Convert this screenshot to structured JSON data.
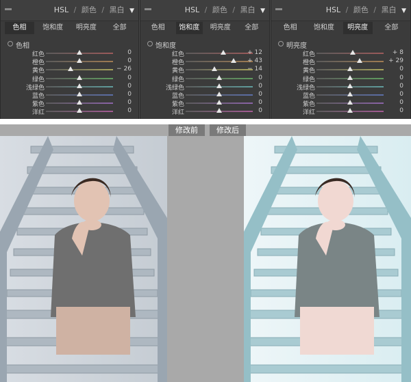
{
  "hsl_panels": [
    {
      "title": "HSL",
      "sep": "/",
      "title2": "颜色",
      "title3": "黑白",
      "tabs": [
        "色相",
        "饱和度",
        "明亮度",
        "全部"
      ],
      "active_tab": 0,
      "section_title": "色相",
      "rows": [
        {
          "label": "红色",
          "value": "0",
          "knob": 0.5,
          "track": "#9b5a5a"
        },
        {
          "label": "橙色",
          "value": "0",
          "knob": 0.5,
          "track": "#a07b52"
        },
        {
          "label": "黄色",
          "value": "− 26",
          "knob": 0.37,
          "track": "#a7a35b"
        },
        {
          "label": "绿色",
          "value": "0",
          "knob": 0.5,
          "track": "#5f9b5f"
        },
        {
          "label": "浅绿色",
          "value": "0",
          "knob": 0.5,
          "track": "#5f9d9d"
        },
        {
          "label": "蓝色",
          "value": "0",
          "knob": 0.5,
          "track": "#5b6ea7"
        },
        {
          "label": "紫色",
          "value": "0",
          "knob": 0.5,
          "track": "#8a63a7"
        },
        {
          "label": "洋红",
          "value": "0",
          "knob": 0.5,
          "track": "#a35a93"
        }
      ]
    },
    {
      "title": "HSL",
      "sep": "/",
      "title2": "颜色",
      "title3": "黑白",
      "tabs": [
        "色相",
        "饱和度",
        "明亮度",
        "全部"
      ],
      "active_tab": 1,
      "section_title": "饱和度",
      "rows": [
        {
          "label": "红色",
          "value": "+ 12",
          "knob": 0.56,
          "track": "#9b5a5a"
        },
        {
          "label": "橙色",
          "value": "+ 43",
          "knob": 0.71,
          "track": "#a07b52"
        },
        {
          "label": "黄色",
          "value": "− 14",
          "knob": 0.43,
          "track": "#a7a35b"
        },
        {
          "label": "绿色",
          "value": "0",
          "knob": 0.5,
          "track": "#5f9b5f"
        },
        {
          "label": "浅绿色",
          "value": "0",
          "knob": 0.5,
          "track": "#5f9d9d"
        },
        {
          "label": "蓝色",
          "value": "0",
          "knob": 0.5,
          "track": "#5b6ea7"
        },
        {
          "label": "紫色",
          "value": "0",
          "knob": 0.5,
          "track": "#8a63a7"
        },
        {
          "label": "洋红",
          "value": "0",
          "knob": 0.5,
          "track": "#a35a93"
        }
      ]
    },
    {
      "title": "HSL",
      "sep": "/",
      "title2": "颜色",
      "title3": "黑白",
      "tabs": [
        "色相",
        "饱和度",
        "明亮度",
        "全部"
      ],
      "active_tab": 2,
      "section_title": "明亮度",
      "rows": [
        {
          "label": "红色",
          "value": "+ 8",
          "knob": 0.54,
          "track": "#9b5a5a"
        },
        {
          "label": "橙色",
          "value": "+ 29",
          "knob": 0.64,
          "track": "#a07b52"
        },
        {
          "label": "黄色",
          "value": "0",
          "knob": 0.5,
          "track": "#a7a35b"
        },
        {
          "label": "绿色",
          "value": "0",
          "knob": 0.5,
          "track": "#5f9b5f"
        },
        {
          "label": "浅绿色",
          "value": "0",
          "knob": 0.5,
          "track": "#5f9d9d"
        },
        {
          "label": "蓝色",
          "value": "0",
          "knob": 0.5,
          "track": "#5b6ea7"
        },
        {
          "label": "紫色",
          "value": "0",
          "knob": 0.5,
          "track": "#8a63a7"
        },
        {
          "label": "洋红",
          "value": "0",
          "knob": 0.5,
          "track": "#a35a93"
        }
      ]
    }
  ],
  "compare": {
    "before_label": "修改前",
    "after_label": "修改后"
  },
  "colors": {
    "panel_bg": "#3b3b3b",
    "text": "#cfcfcf",
    "compare_bg": "#a9a9a9",
    "label_bg": "#7a7a7a"
  }
}
